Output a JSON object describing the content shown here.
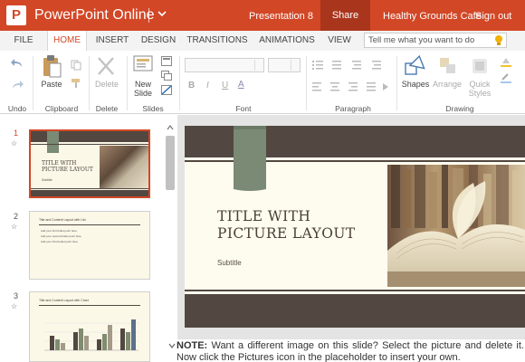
{
  "app": {
    "name": "PowerPoint Online",
    "logo_letter": "P",
    "document_title": "Presentation 8",
    "share_label": "Share",
    "user_name": "Healthy Grounds Cafe",
    "signout_label": "Sign out",
    "accent_color": "#d24726"
  },
  "tabs": [
    {
      "label": "FILE"
    },
    {
      "label": "HOME",
      "active": true
    },
    {
      "label": "INSERT"
    },
    {
      "label": "DESIGN"
    },
    {
      "label": "TRANSITIONS"
    },
    {
      "label": "ANIMATIONS"
    },
    {
      "label": "VIEW"
    }
  ],
  "tell_me": {
    "placeholder": "Tell me what you want to do",
    "icon": "lightbulb-icon"
  },
  "ribbon": {
    "groups": {
      "undo": "Undo",
      "clipboard": "Clipboard",
      "delete": "Delete",
      "slides": "Slides",
      "font": "Font",
      "paragraph": "Paragraph",
      "drawing": "Drawing"
    },
    "paste_label": "Paste",
    "delete_label": "Delete",
    "new_slide_label_1": "New",
    "new_slide_label_2": "Slide",
    "shapes_label": "Shapes",
    "arrange_label": "Arrange",
    "quick_styles_label_1": "Quick",
    "quick_styles_label_2": "Styles",
    "bold": "B",
    "italic": "I",
    "underline": "U",
    "font_color": "A"
  },
  "slides": [
    {
      "number": "1",
      "title": "TITLE WITH PICTURE LAYOUT",
      "subtitle": "Subtitle",
      "selected": true
    },
    {
      "number": "2",
      "title": "Title and Content Layout with List",
      "bullets": [
        "Add your first bullet point here",
        "Add your second bullet point here",
        "Add your third bullet point here"
      ]
    },
    {
      "number": "3",
      "title": "Title and Content Layout with Chart"
    }
  ],
  "current_slide": {
    "title_line1": "TITLE WITH",
    "title_line2": "PICTURE LAYOUT",
    "subtitle": "Subtitle"
  },
  "note": {
    "label": "NOTE:",
    "text": "Want a different image on this slide? Select the picture and delete it. Now click the Pictures icon in the placeholder to insert your own."
  }
}
